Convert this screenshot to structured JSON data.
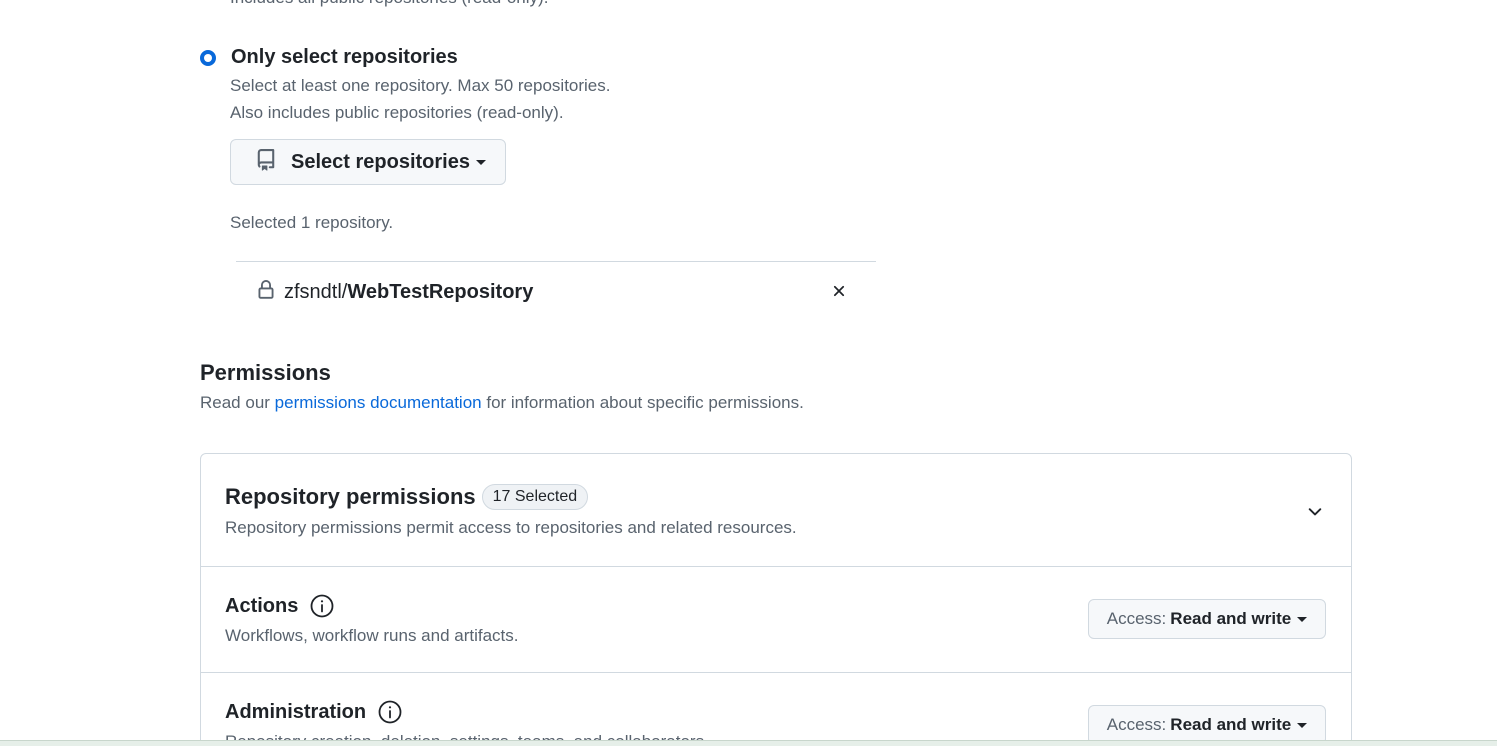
{
  "top_cut_text": "Includes all public repositories (read-only).",
  "repo_access": {
    "option_label": "Only select repositories",
    "option_selected": true,
    "desc_line1": "Select at least one repository. Max 50 repositories.",
    "desc_line2": "Also includes public repositories (read-only).",
    "select_button_label": "Select repositories",
    "selected_count_text": "Selected 1 repository.",
    "selected_repos": [
      {
        "owner": "zfsndtl/",
        "name": "WebTestRepository",
        "icon": "lock-icon"
      }
    ]
  },
  "permissions": {
    "title": "Permissions",
    "desc_prefix": "Read our ",
    "desc_link": "permissions documentation",
    "desc_suffix": " for information about specific permissions.",
    "repository_card": {
      "title": "Repository permissions",
      "counter": "17 Selected",
      "subtitle": "Repository permissions permit access to repositories and related resources.",
      "rows": [
        {
          "name": "Actions",
          "description": "Workflows, workflow runs and artifacts.",
          "access_prefix": "Access:",
          "access_value": "Read and write"
        },
        {
          "name": "Administration",
          "description": "Repository creation, deletion, settings, teams, and collaborators.",
          "access_prefix": "Access:",
          "access_value": "Read and write"
        }
      ]
    }
  },
  "colors": {
    "accent": "#0969da",
    "text": "#1f2328",
    "muted": "#59636e",
    "border": "#d1d9e0",
    "button_bg": "#f6f8fa"
  }
}
